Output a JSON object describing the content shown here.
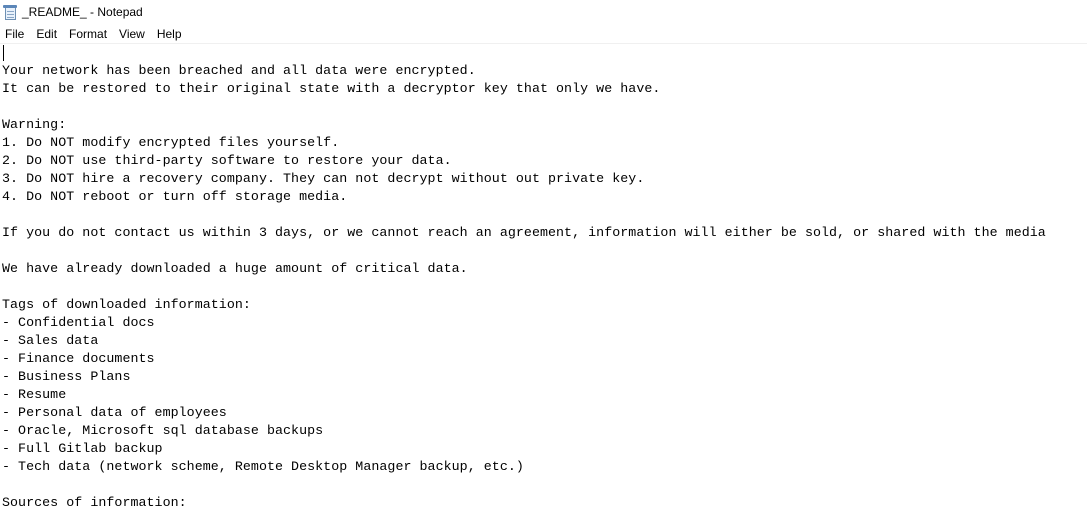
{
  "window": {
    "title": "_README_ - Notepad",
    "icon": "notepad-icon"
  },
  "menu": {
    "items": [
      "File",
      "Edit",
      "Format",
      "View",
      "Help"
    ]
  },
  "document": {
    "lines": [
      "",
      "Your network has been breached and all data were encrypted.",
      "It can be restored to their original state with a decryptor key that only we have.",
      "",
      "Warning:",
      "1. Do NOT modify encrypted files yourself.",
      "2. Do NOT use third-party software to restore your data.",
      "3. Do NOT hire a recovery company. They can not decrypt without out private key.",
      "4. Do NOT reboot or turn off storage media.",
      "",
      "If you do not contact us within 3 days, or we cannot reach an agreement, information will either be sold, or shared with the media",
      "",
      "We have already downloaded a huge amount of critical data.",
      "",
      "Tags of downloaded information:",
      "- Confidential docs",
      "- Sales data",
      "- Finance documents",
      "- Business Plans",
      "- Resume",
      "- Personal data of employees",
      "- Oracle, Microsoft sql database backups",
      "- Full Gitlab backup",
      "- Tech data (network scheme, Remote Desktop Manager backup, etc.)",
      "",
      "Sources of information:"
    ]
  }
}
